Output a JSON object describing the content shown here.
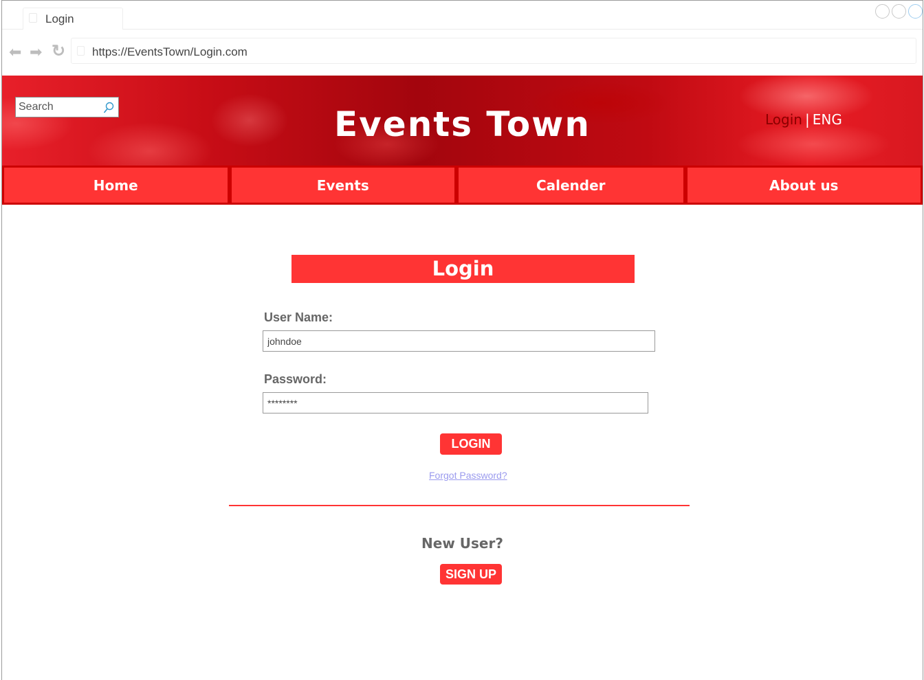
{
  "browser": {
    "tab_title": "Login",
    "url": "https://EventsTown/Login.com"
  },
  "header": {
    "search_placeholder": "Search",
    "site_title": "Events Town",
    "login_link": "Login",
    "separator": "|",
    "language": "ENG"
  },
  "menu": {
    "items": [
      {
        "label": "Home"
      },
      {
        "label": "Events"
      },
      {
        "label": "Calender"
      },
      {
        "label": "About us"
      }
    ]
  },
  "login_form": {
    "heading": "Login",
    "username_label": "User Name:",
    "username_value": "johndoe",
    "password_label": "Password:",
    "password_value": "********",
    "login_button": "LOGIN",
    "forgot_password": "Forgot Password?"
  },
  "signup": {
    "prompt": "New User?",
    "button": "SIGN UP"
  },
  "colors": {
    "accent": "#ff3434",
    "menu_border": "#cc0000",
    "label_text": "#666666",
    "link": "#9a9aee"
  }
}
